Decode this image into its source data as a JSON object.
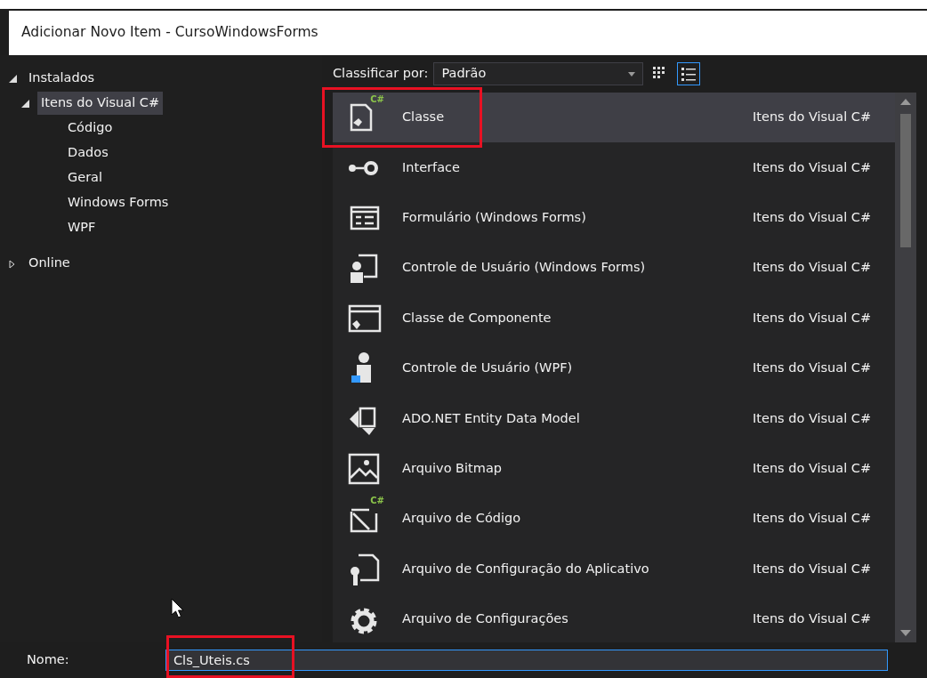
{
  "window": {
    "title": "Adicionar Novo Item - CursoWindowsForms"
  },
  "tree": [
    {
      "label": "Instalados",
      "expanded": true,
      "selected": false,
      "children": [
        {
          "label": "Itens do Visual C#",
          "expanded": true,
          "selected": true,
          "children": [
            {
              "label": "Código",
              "selected": false
            },
            {
              "label": "Dados",
              "selected": false
            },
            {
              "label": "Geral",
              "selected": false
            },
            {
              "label": "Windows Forms",
              "selected": false
            },
            {
              "label": "WPF",
              "selected": false
            }
          ]
        }
      ]
    },
    {
      "label": "Online",
      "expanded": false,
      "selected": false
    }
  ],
  "sort": {
    "label": "Classificar por:",
    "value": "Padrão"
  },
  "view_buttons": [
    {
      "kind": "grid",
      "selected": false
    },
    {
      "kind": "list",
      "selected": true
    }
  ],
  "items": [
    {
      "kind": "class",
      "badge": "C#",
      "name": "Classe",
      "category": "Itens do Visual C#",
      "selected": true,
      "highlighted": true
    },
    {
      "kind": "interface",
      "name": "Interface",
      "category": "Itens do Visual C#",
      "selected": false,
      "highlighted": false
    },
    {
      "kind": "form",
      "name": "Formulário (Windows Forms)",
      "category": "Itens do Visual C#",
      "selected": false,
      "highlighted": false
    },
    {
      "kind": "user-control",
      "name": "Controle de Usuário (Windows Forms)",
      "category": "Itens do Visual C#",
      "selected": false,
      "highlighted": false
    },
    {
      "kind": "component",
      "name": "Classe de Componente",
      "category": "Itens do Visual C#",
      "selected": false,
      "highlighted": false
    },
    {
      "kind": "wpf-control",
      "name": "Controle de Usuário (WPF)",
      "category": "Itens do Visual C#",
      "selected": false,
      "highlighted": false
    },
    {
      "kind": "entity-model",
      "name": "ADO.NET Entity Data Model",
      "category": "Itens do Visual C#",
      "selected": false,
      "highlighted": false
    },
    {
      "kind": "bitmap",
      "name": "Arquivo Bitmap",
      "category": "Itens do Visual C#",
      "selected": false,
      "highlighted": false
    },
    {
      "kind": "code-file",
      "badge": "C#",
      "name": "Arquivo de Código",
      "category": "Itens do Visual C#",
      "selected": false,
      "highlighted": false
    },
    {
      "kind": "config-file",
      "name": "Arquivo de Configuração do Aplicativo",
      "category": "Itens do Visual C#",
      "selected": false,
      "highlighted": false
    },
    {
      "kind": "settings",
      "name": "Arquivo de Configurações",
      "category": "Itens do Visual C#",
      "selected": false,
      "highlighted": false
    }
  ],
  "name_field": {
    "label": "Nome:",
    "value": "Cls_Uteis.cs",
    "highlighted": true
  }
}
